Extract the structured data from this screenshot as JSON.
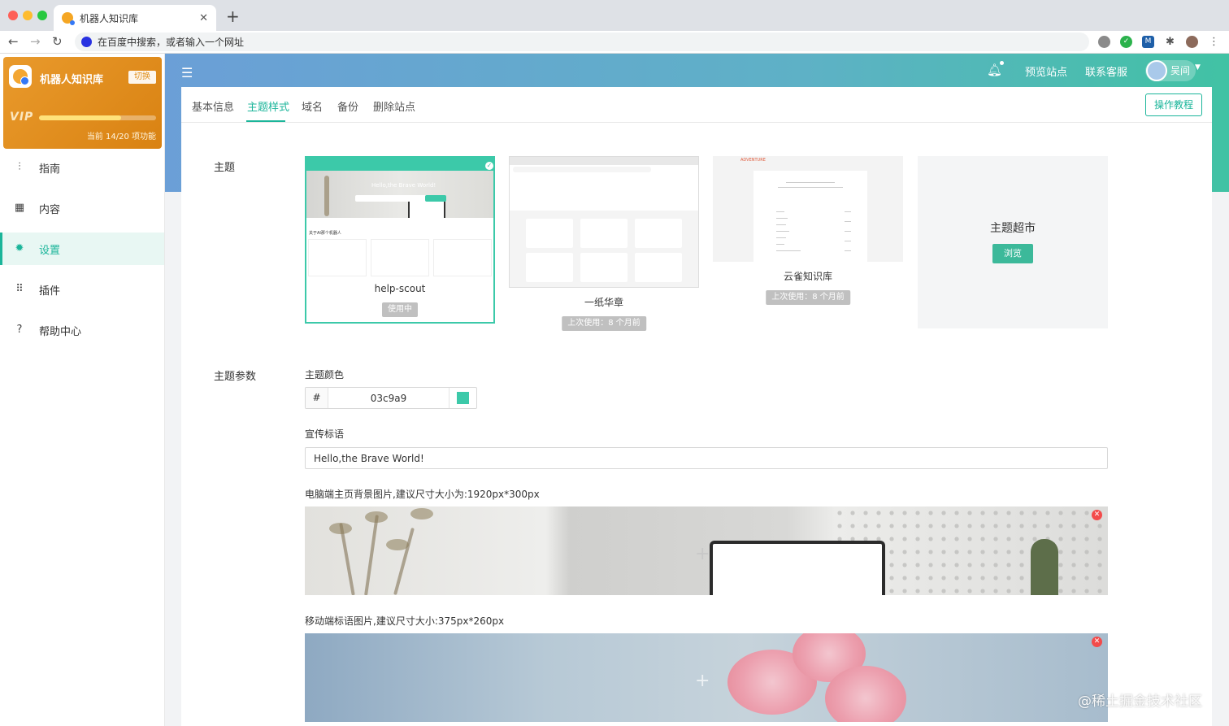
{
  "browser": {
    "tab_title": "机器人知识库",
    "omnibox_placeholder": "在百度中搜索，或者输入一个网址"
  },
  "sidebar": {
    "brand": "机器人知识库",
    "switch_label": "切换",
    "vip_label": "VIP",
    "vip_progress": 0.7,
    "vip_status": "当前 14/20 项功能",
    "menu": [
      {
        "label": "指南",
        "icon": "sliders-icon",
        "active": false
      },
      {
        "label": "内容",
        "icon": "grid-icon",
        "active": false
      },
      {
        "label": "设置",
        "icon": "gear-icon",
        "active": true
      },
      {
        "label": "插件",
        "icon": "apps-icon",
        "active": false
      },
      {
        "label": "帮助中心",
        "icon": "help-icon",
        "active": false
      }
    ]
  },
  "header": {
    "preview_label": "预览站点",
    "support_label": "联系客服",
    "user_name": "吴间"
  },
  "tabs": [
    {
      "label": "基本信息",
      "active": false
    },
    {
      "label": "主题样式",
      "active": true
    },
    {
      "label": "域名",
      "active": false
    },
    {
      "label": "备份",
      "active": false
    },
    {
      "label": "删除站点",
      "active": false
    }
  ],
  "tutorial_label": "操作教程",
  "theme_section_label": "主题",
  "themes": [
    {
      "name": "help-scout",
      "badge": "使用中",
      "selected": true,
      "preview_headline": "Hello,the Brave World!",
      "preview_section": "关于AI那个机器人"
    },
    {
      "name": "一纸华章",
      "badge": "上次使用：8 个月前",
      "selected": false
    },
    {
      "name": "云雀知识库",
      "badge": "上次使用：8 个月前",
      "selected": false,
      "preview_brand": "ADVENTURE"
    }
  ],
  "market": {
    "title": "主题超市",
    "browse_label": "浏览"
  },
  "params": {
    "section_label": "主题参数",
    "color_label": "主题颜色",
    "color_prefix": "#",
    "color_value": "03c9a9",
    "color_swatch": "#3cc9a9",
    "slogan_label": "宣传标语",
    "slogan_value": "Hello,the Brave World!",
    "pc_bg_label": "电脑端主页背景图片,建议尺寸大小为:1920px*300px",
    "mobile_bg_label": "移动端标语图片,建议尺寸大小:375px*260px"
  },
  "watermark": "@稀土掘金技术社区",
  "colors": {
    "accent": "#1bb59a",
    "swatch": "#3cc9a9",
    "delete": "#f34b4b"
  }
}
